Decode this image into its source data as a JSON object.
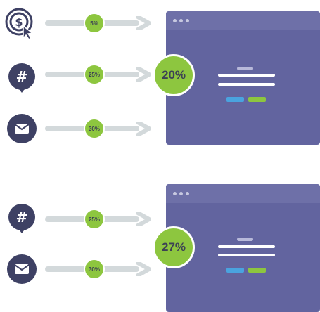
{
  "colors": {
    "accent_green": "#8dc63f",
    "icon_navy": "#3e4164",
    "arrow_gray": "#d3d9db",
    "window_purple": "#62649f",
    "window_titlebar": "#6e70a8",
    "cta_blue": "#4aa3df"
  },
  "top": {
    "channels": [
      {
        "icon": "dollar-cursor-icon",
        "rate": "5%"
      },
      {
        "icon": "hashtag-chat-icon",
        "rate": "25%"
      },
      {
        "icon": "envelope-icon",
        "rate": "30%"
      }
    ],
    "conversion": "20%"
  },
  "bottom": {
    "channels": [
      {
        "icon": "hashtag-chat-icon",
        "rate": "25%"
      },
      {
        "icon": "envelope-icon",
        "rate": "30%"
      }
    ],
    "conversion": "27%"
  }
}
